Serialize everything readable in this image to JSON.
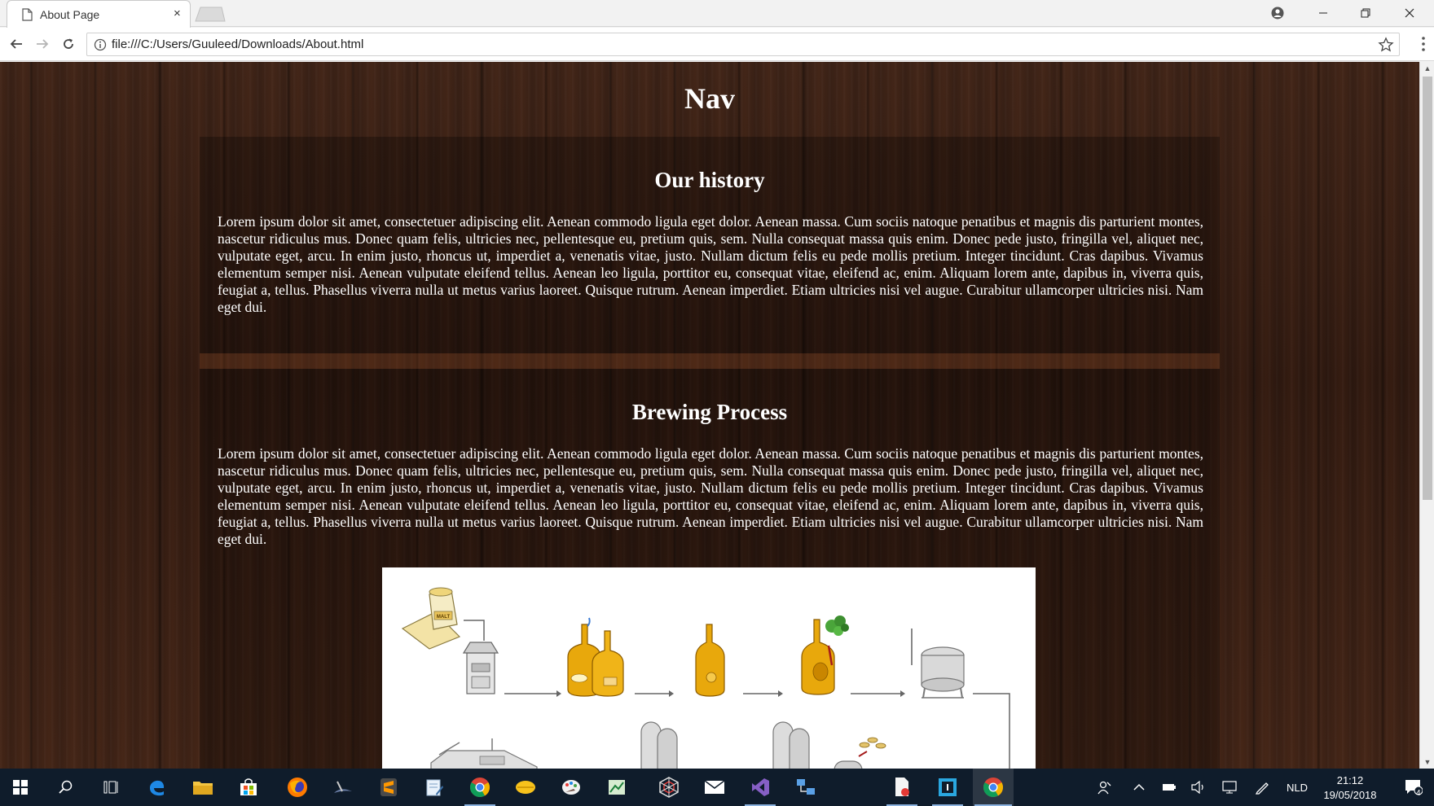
{
  "browser": {
    "tab_title": "About Page",
    "tab_close": "×",
    "url": "file:///C:/Users/Guuleed/Downloads/About.html"
  },
  "page": {
    "nav_title": "Nav",
    "sections": [
      {
        "title": "Our history",
        "text": "Lorem ipsum dolor sit amet, consectetuer adipiscing elit. Aenean commodo ligula eget dolor. Aenean massa. Cum sociis natoque penatibus et magnis dis parturient montes, nascetur ridiculus mus. Donec quam felis, ultricies nec, pellentesque eu, pretium quis, sem. Nulla consequat massa quis enim. Donec pede justo, fringilla vel, aliquet nec, vulputate eget, arcu. In enim justo, rhoncus ut, imperdiet a, venenatis vitae, justo. Nullam dictum felis eu pede mollis pretium. Integer tincidunt. Cras dapibus. Vivamus elementum semper nisi. Aenean vulputate eleifend tellus. Aenean leo ligula, porttitor eu, consequat vitae, eleifend ac, enim. Aliquam lorem ante, dapibus in, viverra quis, feugiat a, tellus. Phasellus viverra nulla ut metus varius laoreet. Quisque rutrum. Aenean imperdiet. Etiam ultricies nisi vel augue. Curabitur ullamcorper ultricies nisi. Nam eget dui."
      },
      {
        "title": "Brewing Process",
        "text": "Lorem ipsum dolor sit amet, consectetuer adipiscing elit. Aenean commodo ligula eget dolor. Aenean massa. Cum sociis natoque penatibus et magnis dis parturient montes, nascetur ridiculus mus. Donec quam felis, ultricies nec, pellentesque eu, pretium quis, sem. Nulla consequat massa quis enim. Donec pede justo, fringilla vel, aliquet nec, vulputate eget, arcu. In enim justo, rhoncus ut, imperdiet a, venenatis vitae, justo. Nullam dictum felis eu pede mollis pretium. Integer tincidunt. Cras dapibus. Vivamus elementum semper nisi. Aenean vulputate eleifend tellus. Aenean leo ligula, porttitor eu, consequat vitae, eleifend ac, enim. Aliquam lorem ante, dapibus in, viverra quis, feugiat a, tellus. Phasellus viverra nulla ut metus varius laoreet. Quisque rutrum. Aenean imperdiet. Etiam ultricies nisi vel augue. Curabitur ullamcorper ultricies nisi. Nam eget dui."
      }
    ],
    "diagram": {
      "malt_bag_label": "MALT",
      "icons": [
        "malt-bag-icon",
        "mill-icon",
        "mash-tun-icon",
        "lauter-tun-icon",
        "brew-kettle-icon",
        "fermentation-tank-icon",
        "silo-icon",
        "hops-icon"
      ]
    }
  },
  "taskbar": {
    "language": "NLD",
    "time": "21:12",
    "date": "19/05/2018",
    "notification_count": "4",
    "apps": [
      "start",
      "search",
      "task-view",
      "edge",
      "file-explorer",
      "store",
      "firefox",
      "ssms",
      "sublime-text",
      "notepad",
      "chrome",
      "yellow-app",
      "paint",
      "excel",
      "network-app",
      "mail",
      "visual-studio",
      "remote-desktop",
      "pdf-app",
      "code-app",
      "chrome-active"
    ]
  },
  "colors": {
    "wood_dark": "#2e1a12",
    "taskbar": "#0f1c2b",
    "brew_gold": "#e8a80c",
    "accent_blue": "#8cb3e0"
  }
}
